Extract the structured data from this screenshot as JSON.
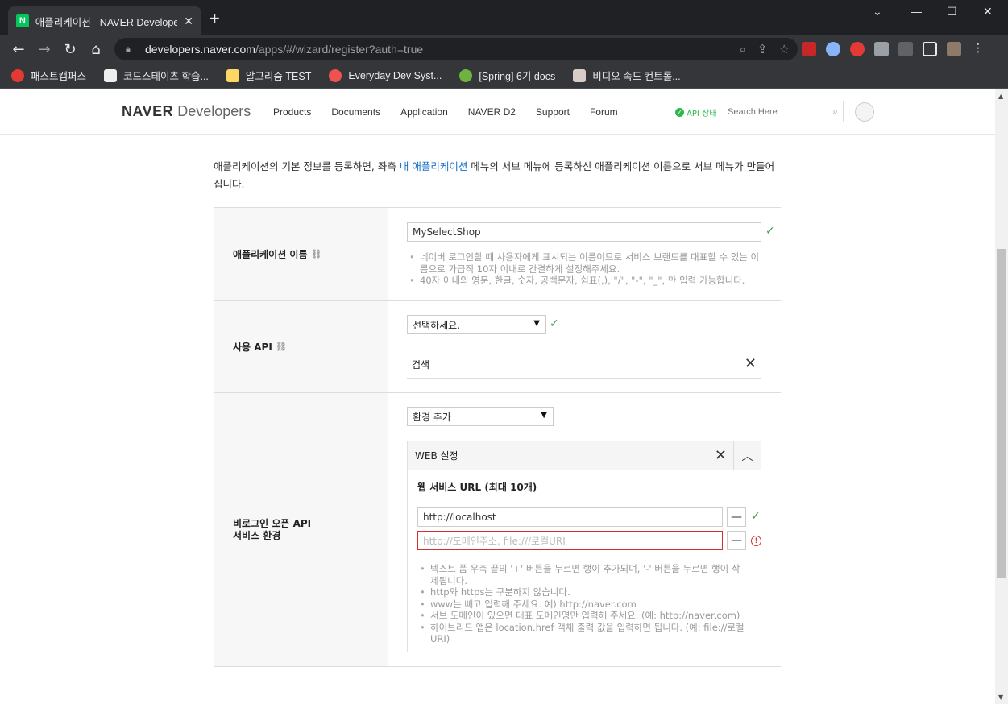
{
  "browser": {
    "tab_title": "애플리케이션 - NAVER Develope",
    "tab_favicon": "N",
    "url_host": "developers.naver.com",
    "url_path": "/apps/#/wizard/register?auth=true",
    "bookmarks": [
      "패스트캠퍼스",
      "코드스테이츠 학습...",
      "알고리즘 TEST",
      "Everyday Dev Syst...",
      "[Spring] 6기 docs",
      "비디오 속도 컨트롤..."
    ]
  },
  "header": {
    "logo_bold": "NAVER",
    "logo_light": "Developers",
    "nav": [
      "Products",
      "Documents",
      "Application",
      "NAVER D2",
      "Support",
      "Forum"
    ],
    "api_status": "API 상태",
    "search_placeholder": "Search Here"
  },
  "intro": {
    "before": "애플리케이션의 기본 정보를 등록하면, 좌측 ",
    "link": "내 애플리케이션",
    "after": " 메뉴의 서브 메뉴에 등록하신 애플리케이션 이름으로 서브 메뉴가 만들어집니다."
  },
  "form": {
    "app_name": {
      "label": "애플리케이션 이름",
      "value": "MySelectShop",
      "help": [
        "네이버 로그인할 때 사용자에게 표시되는 이름이므로 서비스 브랜드를 대표할 수 있는 이름으로 가급적 10자 이내로 간결하게 설정해주세요.",
        "40자 이내의 영문, 한글, 숫자, 공백문자, 쉼표(,), \"/\", \"-\", \"_\", 만 입력 가능합니다."
      ]
    },
    "api": {
      "label": "사용 API",
      "select": "선택하세요.",
      "selected_item": "검색"
    },
    "env": {
      "label_line1": "비로그인 오픈 API",
      "label_line2": "서비스 환경",
      "select": "환경 추가",
      "panel_title": "WEB 설정",
      "url_title": "웹 서비스 URL (최대 10개)",
      "url_value": "http://localhost",
      "url_placeholder": "http://도메인주소, file:///로컬URI",
      "help": [
        "텍스트 폼 우측 끝의 '+' 버튼을 누르면 행이 추가되며, '-' 버튼을 누르면 행이 삭제됩니다.",
        "http와 https는 구분하지 않습니다.",
        "www는 빼고 입력해 주세요. 예) http://naver.com",
        "서브 도메인이 있으면 대표 도메인명만 입력해 주세요. (예: http://naver.com)",
        "하이브리드 앱은 location.href 객체 출력 값을 입력하면 됩니다. (예: file://로컬 URI)"
      ]
    }
  },
  "colors": {
    "check": "#3c9b4b",
    "link": "#1a73c9",
    "error": "#d32f2f",
    "status": "#2eb84b"
  }
}
